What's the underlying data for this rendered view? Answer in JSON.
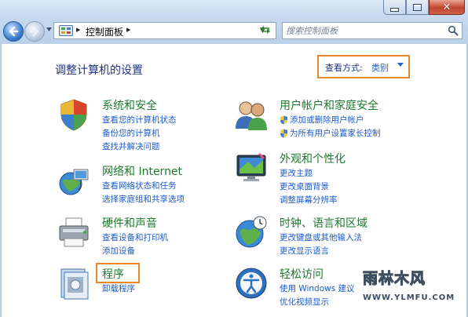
{
  "window": {
    "controls": {
      "minimize": "minimize",
      "maximize": "maximize",
      "close": "close"
    }
  },
  "nav": {
    "breadcrumb": "控制面板",
    "search_placeholder": "搜索控制面板"
  },
  "main": {
    "title": "调整计算机的设置",
    "view_mode_label": "查看方式:",
    "view_mode_value": "类别"
  },
  "categories": [
    {
      "title": "系统和安全",
      "icon": "shield-icon",
      "links": [
        "查看您的计算机状态",
        "备份您的计算机",
        "查找并解决问题"
      ]
    },
    {
      "title": "网络和 Internet",
      "icon": "network-globe-icon",
      "links": [
        "查看网络状态和任务",
        "选择家庭组和共享选项"
      ]
    },
    {
      "title": "硬件和声音",
      "icon": "printer-icon",
      "links": [
        "查看设备和打印机",
        "添加设备"
      ]
    },
    {
      "title": "程序",
      "icon": "programs-icon",
      "links": [
        "卸载程序"
      ]
    },
    {
      "title": "用户帐户和家庭安全",
      "icon": "users-icon",
      "links": [
        "添加或删除用户帐户",
        "为所有用户设置家长控制"
      ]
    },
    {
      "title": "外观和个性化",
      "icon": "display-icon",
      "links": [
        "更改主题",
        "更改桌面背景",
        "调整屏幕分辨率"
      ]
    },
    {
      "title": "时钟、语言和区域",
      "icon": "clock-globe-icon",
      "links": [
        "更改键盘或其他输入法",
        "更改显示语言"
      ]
    },
    {
      "title": "轻松访问",
      "icon": "ease-of-access-icon",
      "links": [
        "使用 Windows 建议",
        "优化视频显示"
      ]
    }
  ],
  "watermark": {
    "title": "雨林木风",
    "url": "WWW.YLMFU.COM"
  },
  "colors": {
    "accent_highlight": "#e8862a",
    "category_title": "#1c7a2c",
    "link": "#1e5bc8",
    "heading": "#1e3287"
  }
}
